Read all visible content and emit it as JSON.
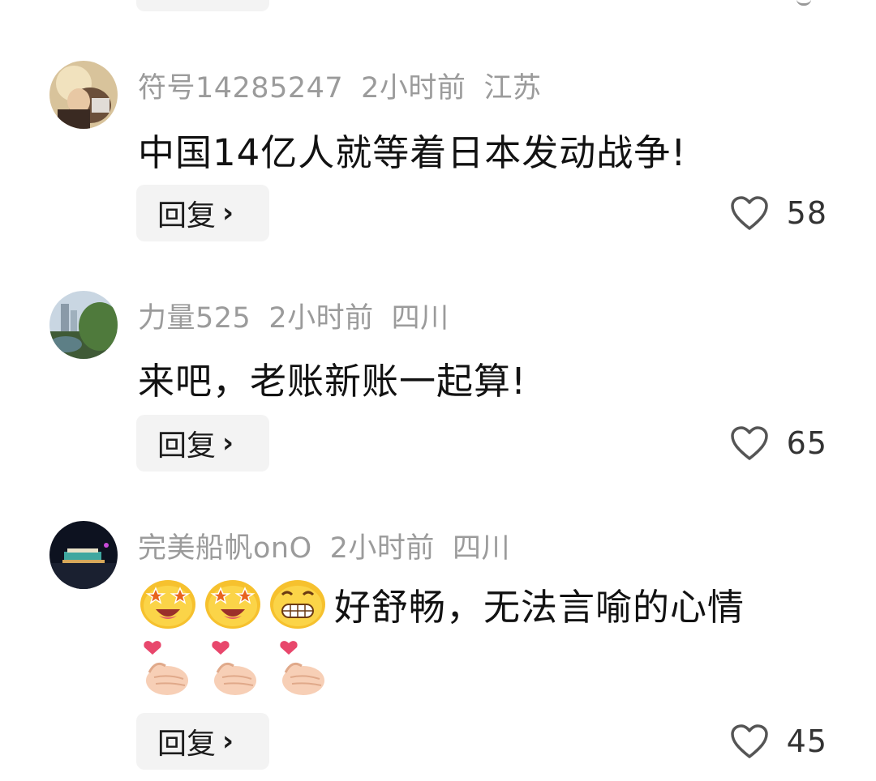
{
  "comments": [
    {
      "username": "符号14285247",
      "time": "2小时前",
      "location": "江苏",
      "text": "中国14亿人就等着日本发动战争!",
      "reply_label": "回复",
      "likes": "58",
      "avatar": "avatar-photo-person"
    },
    {
      "username": "力量525",
      "time": "2小时前",
      "location": "四川",
      "text": "来吧，老账新账一起算!",
      "reply_label": "回复",
      "likes": "65",
      "avatar": "avatar-photo-landscape"
    },
    {
      "username": "完美船帆onO",
      "time": "2小时前",
      "location": "四川",
      "text": "好舒畅，无法言喻的心情",
      "emoji_leading": [
        "star-struck-emoji",
        "star-struck-emoji",
        "grinning-emoji"
      ],
      "emoji_trailing": [
        "finger-heart-emoji",
        "finger-heart-emoji",
        "finger-heart-emoji"
      ],
      "reply_label": "回复",
      "likes": "45",
      "avatar": "avatar-photo-night"
    }
  ],
  "icons": {
    "like": "heart-outline-icon",
    "reply_chevron": "chevron-right-icon"
  },
  "colors": {
    "meta_text": "#9b9b9b",
    "body_text": "#121212",
    "reply_bg": "#f3f3f3",
    "like_icon": "#555555"
  }
}
